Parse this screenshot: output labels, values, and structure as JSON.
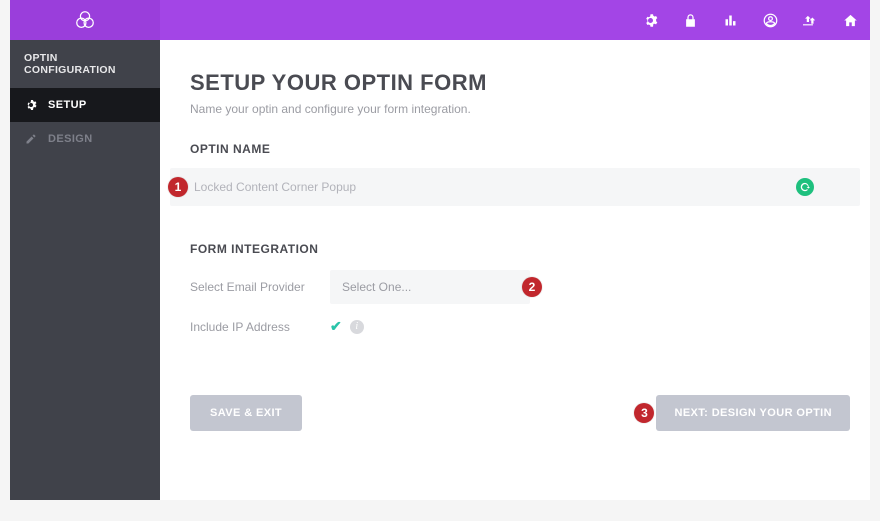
{
  "topbar": {
    "icons": [
      {
        "name": "gear-icon"
      },
      {
        "name": "lock-icon"
      },
      {
        "name": "stats-icon"
      },
      {
        "name": "user-icon"
      },
      {
        "name": "upload-icon"
      },
      {
        "name": "home-icon"
      }
    ]
  },
  "sidebar": {
    "title": "OPTIN CONFIGURATION",
    "items": [
      {
        "icon": "gear-icon",
        "label": "SETUP",
        "active": true
      },
      {
        "icon": "pencil-icon",
        "label": "DESIGN",
        "active": false
      }
    ]
  },
  "main": {
    "heading": "SETUP YOUR OPTIN FORM",
    "sub": "Name your optin and configure your form integration.",
    "section_optin_name": "OPTIN NAME",
    "optin_name_value": "Locked Content Corner Popup",
    "section_form_integration": "FORM INTEGRATION",
    "provider_label": "Select Email Provider",
    "provider_placeholder": "Select One...",
    "ip_label": "Include IP Address",
    "ip_checked": true,
    "buttons": {
      "save_exit": "SAVE & EXIT",
      "next": "NEXT: DESIGN YOUR OPTIN"
    }
  },
  "callouts": {
    "one": "1",
    "two": "2",
    "three": "3"
  }
}
